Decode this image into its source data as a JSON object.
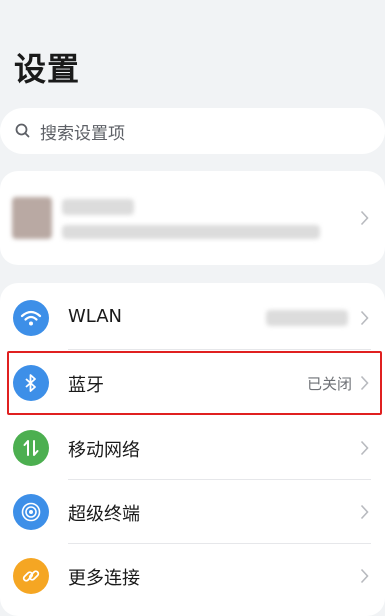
{
  "page": {
    "title": "设置"
  },
  "search": {
    "placeholder": "搜索设置项"
  },
  "items": [
    {
      "label": "WLAN",
      "value": "",
      "icon": "wifi-icon",
      "color": "#3d8fe8"
    },
    {
      "label": "蓝牙",
      "value": "已关闭",
      "icon": "bluetooth-icon",
      "color": "#3d8fe8"
    },
    {
      "label": "移动网络",
      "value": "",
      "icon": "mobile-data-icon",
      "color": "#4caf50"
    },
    {
      "label": "超级终端",
      "value": "",
      "icon": "super-device-icon",
      "color": "#3d8fe8"
    },
    {
      "label": "更多连接",
      "value": "",
      "icon": "link-icon",
      "color": "#f5a623"
    }
  ]
}
